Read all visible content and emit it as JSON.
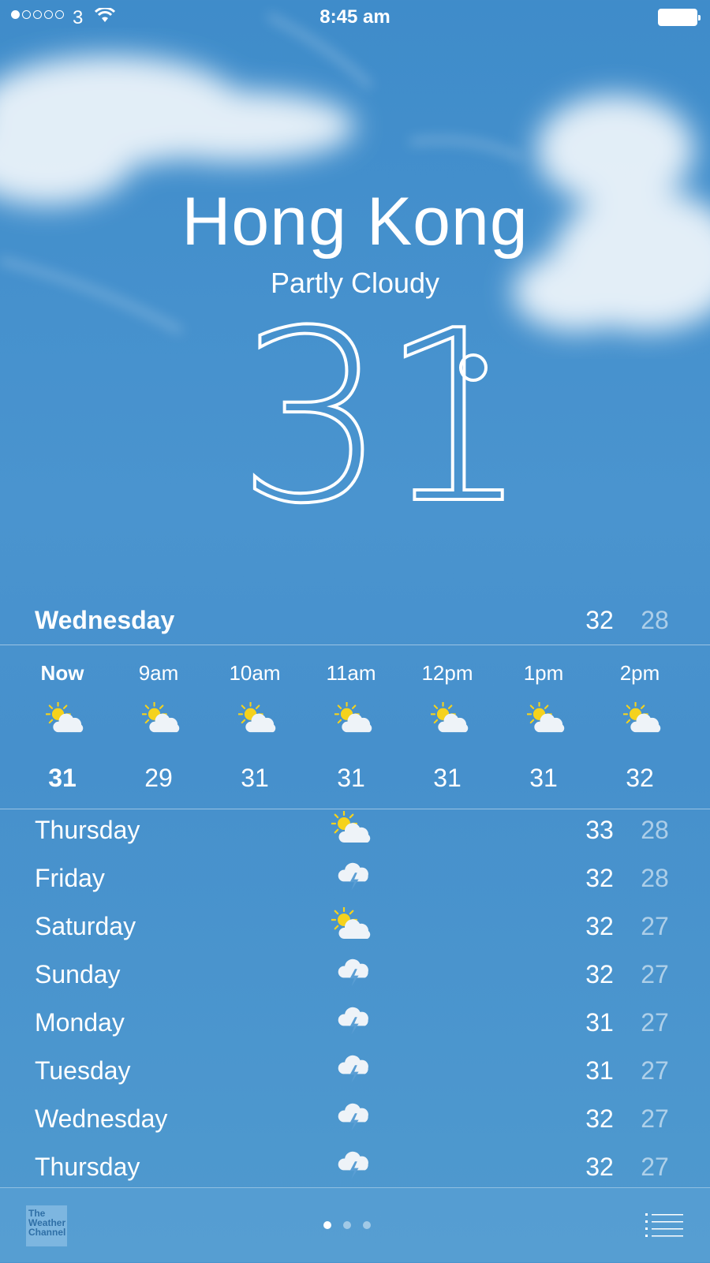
{
  "status": {
    "carrier": "3",
    "time": "8:45 am"
  },
  "location": {
    "city": "Hong Kong",
    "condition": "Partly Cloudy",
    "temperature": "31",
    "degree_symbol": "°"
  },
  "today": {
    "day": "Wednesday",
    "high": "32",
    "low": "28"
  },
  "hourly": [
    {
      "label": "Now",
      "icon": "partly-cloudy-icon",
      "temp": "31"
    },
    {
      "label": "9am",
      "icon": "partly-cloudy-icon",
      "temp": "29"
    },
    {
      "label": "10am",
      "icon": "partly-cloudy-icon",
      "temp": "31"
    },
    {
      "label": "11am",
      "icon": "partly-cloudy-icon",
      "temp": "31"
    },
    {
      "label": "12pm",
      "icon": "partly-cloudy-icon",
      "temp": "31"
    },
    {
      "label": "1pm",
      "icon": "partly-cloudy-icon",
      "temp": "31"
    },
    {
      "label": "2pm",
      "icon": "partly-cloudy-icon",
      "temp": "32"
    }
  ],
  "daily": [
    {
      "day": "Thursday",
      "icon": "partly-cloudy-icon",
      "high": "33",
      "low": "28"
    },
    {
      "day": "Friday",
      "icon": "thunderstorm-icon",
      "high": "32",
      "low": "28"
    },
    {
      "day": "Saturday",
      "icon": "partly-cloudy-icon",
      "high": "32",
      "low": "27"
    },
    {
      "day": "Sunday",
      "icon": "thunderstorm-icon",
      "high": "32",
      "low": "27"
    },
    {
      "day": "Monday",
      "icon": "thunderstorm-icon",
      "high": "31",
      "low": "27"
    },
    {
      "day": "Tuesday",
      "icon": "thunderstorm-icon",
      "high": "31",
      "low": "27"
    },
    {
      "day": "Wednesday",
      "icon": "thunderstorm-icon",
      "high": "32",
      "low": "27"
    },
    {
      "day": "Thursday",
      "icon": "thunderstorm-icon",
      "high": "32",
      "low": "27"
    }
  ],
  "footer": {
    "logo_text": "The Weather Channel",
    "page_count": 3,
    "active_page": 0
  },
  "colors": {
    "sun": "#f5d21c",
    "cloud": "#eef3f8",
    "low_temp": "rgba(255,255,255,0.55)"
  }
}
